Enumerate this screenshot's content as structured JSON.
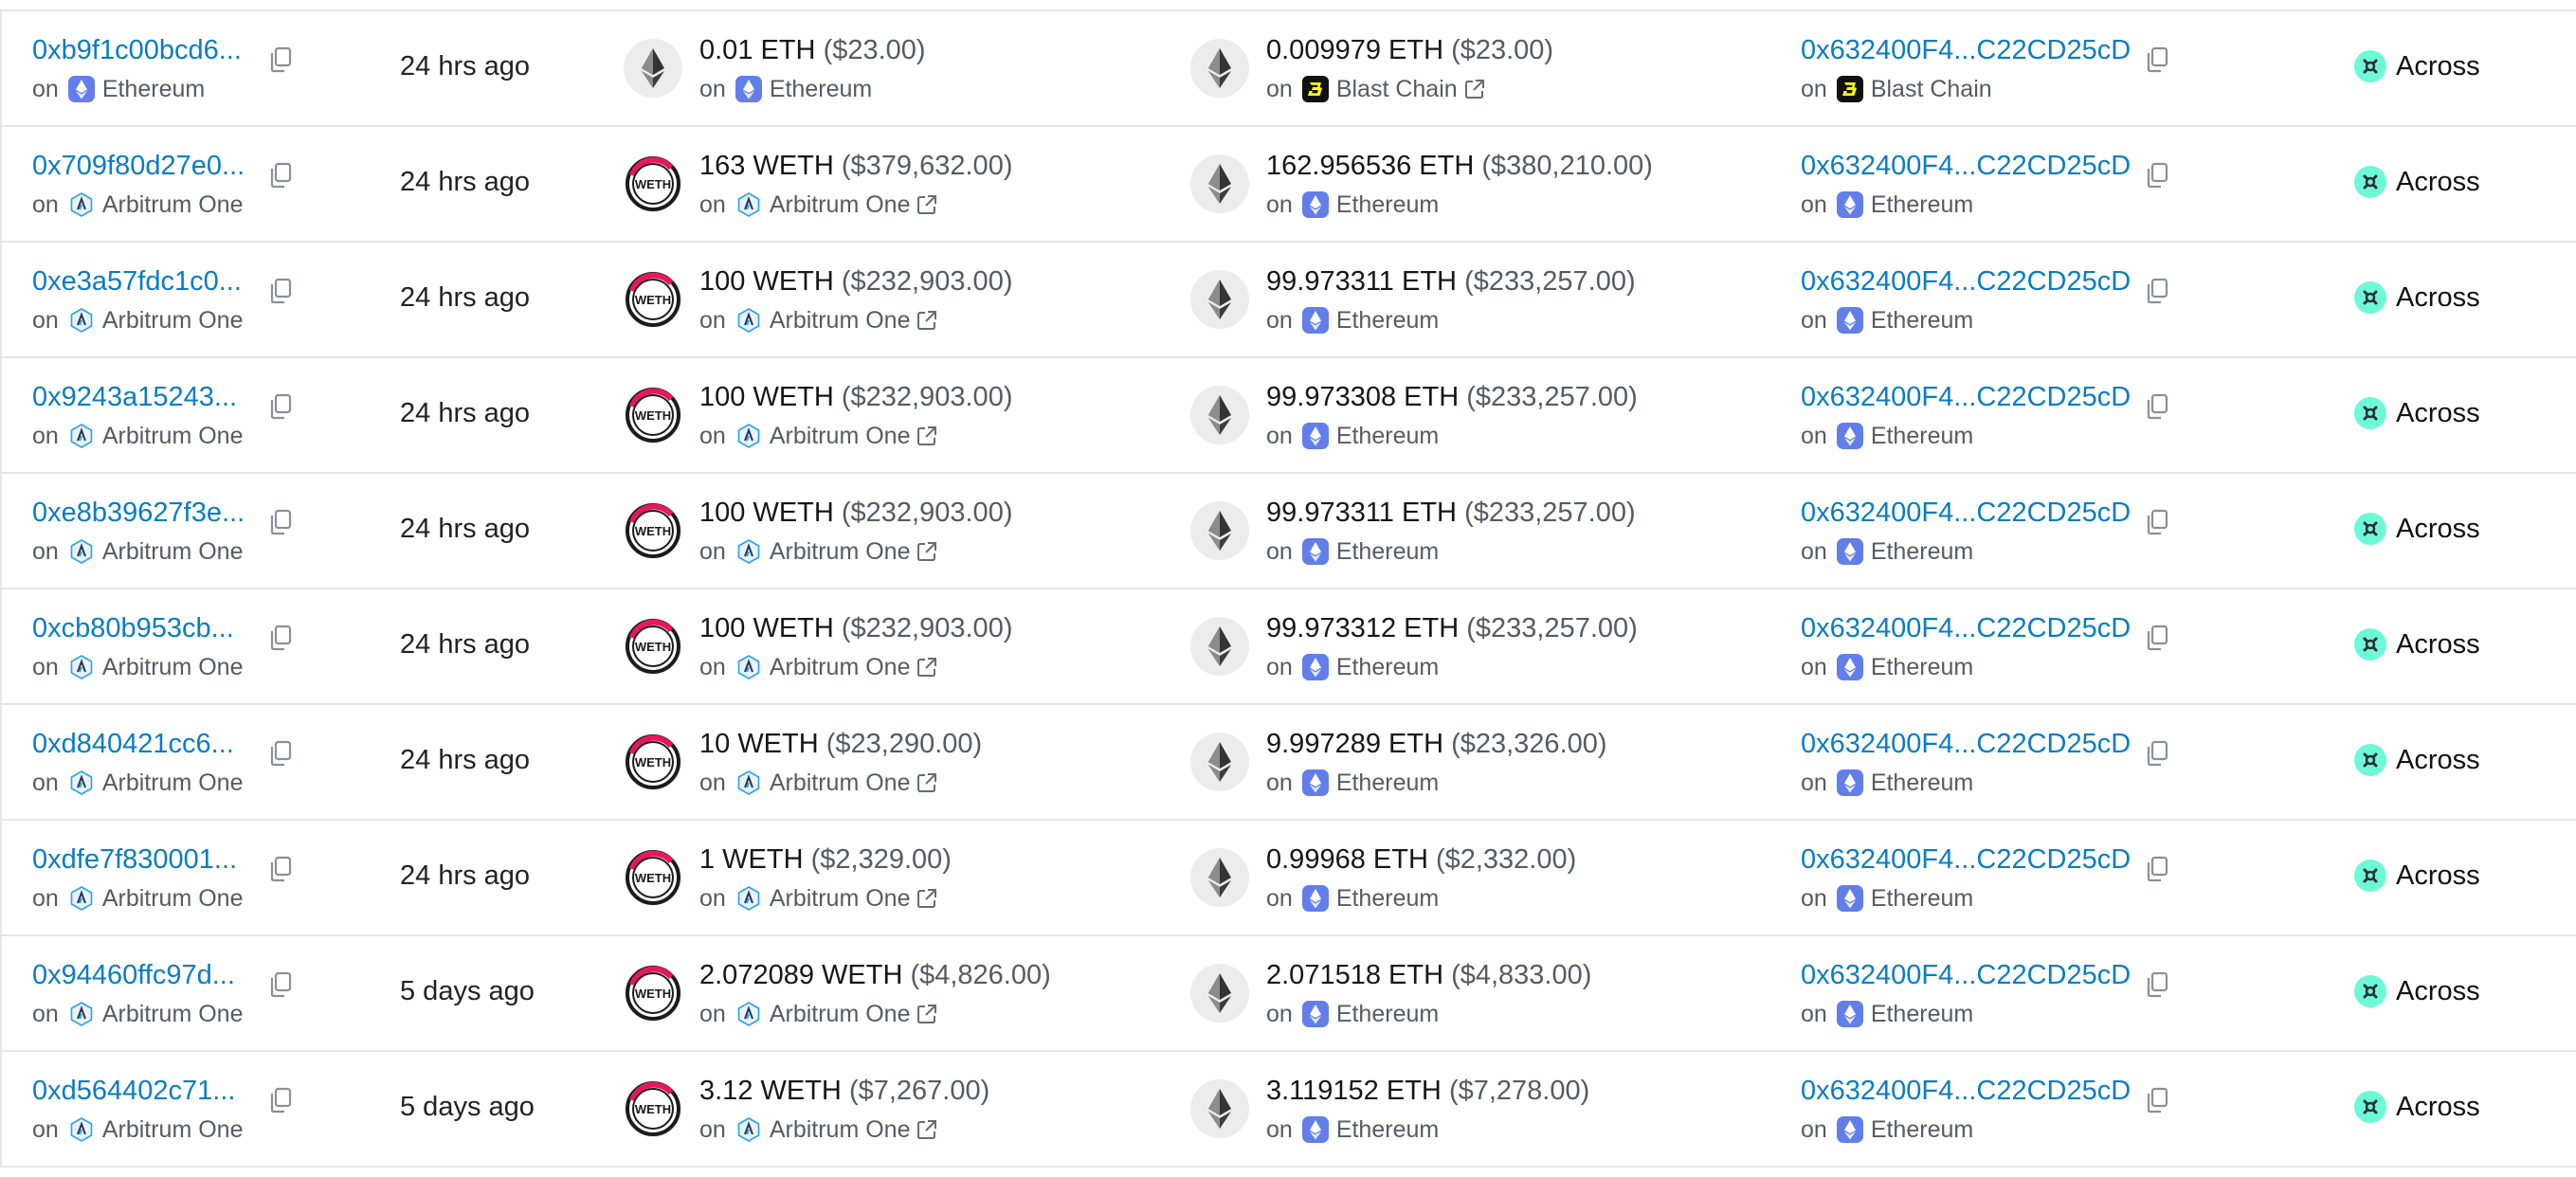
{
  "rows": [
    {
      "tx_hash": "0xb9f1c00bcd6...",
      "tx_chain": "Ethereum",
      "tx_chain_icon": "ethereum-icon",
      "time": "24 hrs ago",
      "from_token_icon": "eth-token-icon",
      "from_amount": "0.01 ETH",
      "from_usd": "($23.00)",
      "from_chain": "Ethereum",
      "from_chain_icon": "ethereum-icon",
      "from_external": false,
      "to_token_icon": "eth-token-icon",
      "to_amount": "0.009979 ETH",
      "to_usd": "($23.00)",
      "to_chain": "Blast Chain",
      "to_chain_icon": "blast-icon",
      "to_external": true,
      "address": "0x632400F4...C22CD25cD",
      "address_chain": "Blast Chain",
      "address_chain_icon": "blast-icon",
      "bridge": "Across"
    },
    {
      "tx_hash": "0x709f80d27e0...",
      "tx_chain": "Arbitrum One",
      "tx_chain_icon": "arbitrum-icon",
      "time": "24 hrs ago",
      "from_token_icon": "weth-token-icon",
      "from_amount": "163 WETH",
      "from_usd": "($379,632.00)",
      "from_chain": "Arbitrum One",
      "from_chain_icon": "arbitrum-icon",
      "from_external": true,
      "to_token_icon": "eth-token-icon",
      "to_amount": "162.956536 ETH",
      "to_usd": "($380,210.00)",
      "to_chain": "Ethereum",
      "to_chain_icon": "ethereum-icon",
      "to_external": false,
      "address": "0x632400F4...C22CD25cD",
      "address_chain": "Ethereum",
      "address_chain_icon": "ethereum-icon",
      "bridge": "Across"
    },
    {
      "tx_hash": "0xe3a57fdc1c0...",
      "tx_chain": "Arbitrum One",
      "tx_chain_icon": "arbitrum-icon",
      "time": "24 hrs ago",
      "from_token_icon": "weth-token-icon",
      "from_amount": "100 WETH",
      "from_usd": "($232,903.00)",
      "from_chain": "Arbitrum One",
      "from_chain_icon": "arbitrum-icon",
      "from_external": true,
      "to_token_icon": "eth-token-icon",
      "to_amount": "99.973311 ETH",
      "to_usd": "($233,257.00)",
      "to_chain": "Ethereum",
      "to_chain_icon": "ethereum-icon",
      "to_external": false,
      "address": "0x632400F4...C22CD25cD",
      "address_chain": "Ethereum",
      "address_chain_icon": "ethereum-icon",
      "bridge": "Across"
    },
    {
      "tx_hash": "0x9243a15243...",
      "tx_chain": "Arbitrum One",
      "tx_chain_icon": "arbitrum-icon",
      "time": "24 hrs ago",
      "from_token_icon": "weth-token-icon",
      "from_amount": "100 WETH",
      "from_usd": "($232,903.00)",
      "from_chain": "Arbitrum One",
      "from_chain_icon": "arbitrum-icon",
      "from_external": true,
      "to_token_icon": "eth-token-icon",
      "to_amount": "99.973308 ETH",
      "to_usd": "($233,257.00)",
      "to_chain": "Ethereum",
      "to_chain_icon": "ethereum-icon",
      "to_external": false,
      "address": "0x632400F4...C22CD25cD",
      "address_chain": "Ethereum",
      "address_chain_icon": "ethereum-icon",
      "bridge": "Across"
    },
    {
      "tx_hash": "0xe8b39627f3e...",
      "tx_chain": "Arbitrum One",
      "tx_chain_icon": "arbitrum-icon",
      "time": "24 hrs ago",
      "from_token_icon": "weth-token-icon",
      "from_amount": "100 WETH",
      "from_usd": "($232,903.00)",
      "from_chain": "Arbitrum One",
      "from_chain_icon": "arbitrum-icon",
      "from_external": true,
      "to_token_icon": "eth-token-icon",
      "to_amount": "99.973311 ETH",
      "to_usd": "($233,257.00)",
      "to_chain": "Ethereum",
      "to_chain_icon": "ethereum-icon",
      "to_external": false,
      "address": "0x632400F4...C22CD25cD",
      "address_chain": "Ethereum",
      "address_chain_icon": "ethereum-icon",
      "bridge": "Across"
    },
    {
      "tx_hash": "0xcb80b953cb...",
      "tx_chain": "Arbitrum One",
      "tx_chain_icon": "arbitrum-icon",
      "time": "24 hrs ago",
      "from_token_icon": "weth-token-icon",
      "from_amount": "100 WETH",
      "from_usd": "($232,903.00)",
      "from_chain": "Arbitrum One",
      "from_chain_icon": "arbitrum-icon",
      "from_external": true,
      "to_token_icon": "eth-token-icon",
      "to_amount": "99.973312 ETH",
      "to_usd": "($233,257.00)",
      "to_chain": "Ethereum",
      "to_chain_icon": "ethereum-icon",
      "to_external": false,
      "address": "0x632400F4...C22CD25cD",
      "address_chain": "Ethereum",
      "address_chain_icon": "ethereum-icon",
      "bridge": "Across"
    },
    {
      "tx_hash": "0xd840421cc6...",
      "tx_chain": "Arbitrum One",
      "tx_chain_icon": "arbitrum-icon",
      "time": "24 hrs ago",
      "from_token_icon": "weth-token-icon",
      "from_amount": "10 WETH",
      "from_usd": "($23,290.00)",
      "from_chain": "Arbitrum One",
      "from_chain_icon": "arbitrum-icon",
      "from_external": true,
      "to_token_icon": "eth-token-icon",
      "to_amount": "9.997289 ETH",
      "to_usd": "($23,326.00)",
      "to_chain": "Ethereum",
      "to_chain_icon": "ethereum-icon",
      "to_external": false,
      "address": "0x632400F4...C22CD25cD",
      "address_chain": "Ethereum",
      "address_chain_icon": "ethereum-icon",
      "bridge": "Across"
    },
    {
      "tx_hash": "0xdfe7f830001...",
      "tx_chain": "Arbitrum One",
      "tx_chain_icon": "arbitrum-icon",
      "time": "24 hrs ago",
      "from_token_icon": "weth-token-icon",
      "from_amount": "1 WETH",
      "from_usd": "($2,329.00)",
      "from_chain": "Arbitrum One",
      "from_chain_icon": "arbitrum-icon",
      "from_external": true,
      "to_token_icon": "eth-token-icon",
      "to_amount": "0.99968 ETH",
      "to_usd": "($2,332.00)",
      "to_chain": "Ethereum",
      "to_chain_icon": "ethereum-icon",
      "to_external": false,
      "address": "0x632400F4...C22CD25cD",
      "address_chain": "Ethereum",
      "address_chain_icon": "ethereum-icon",
      "bridge": "Across"
    },
    {
      "tx_hash": "0x94460ffc97d...",
      "tx_chain": "Arbitrum One",
      "tx_chain_icon": "arbitrum-icon",
      "time": "5 days ago",
      "from_token_icon": "weth-token-icon",
      "from_amount": "2.072089 WETH",
      "from_usd": "($4,826.00)",
      "from_chain": "Arbitrum One",
      "from_chain_icon": "arbitrum-icon",
      "from_external": true,
      "to_token_icon": "eth-token-icon",
      "to_amount": "2.071518 ETH",
      "to_usd": "($4,833.00)",
      "to_chain": "Ethereum",
      "to_chain_icon": "ethereum-icon",
      "to_external": false,
      "address": "0x632400F4...C22CD25cD",
      "address_chain": "Ethereum",
      "address_chain_icon": "ethereum-icon",
      "bridge": "Across"
    },
    {
      "tx_hash": "0xd564402c71...",
      "tx_chain": "Arbitrum One",
      "tx_chain_icon": "arbitrum-icon",
      "time": "5 days ago",
      "from_token_icon": "weth-token-icon",
      "from_amount": "3.12 WETH",
      "from_usd": "($7,267.00)",
      "from_chain": "Arbitrum One",
      "from_chain_icon": "arbitrum-icon",
      "from_external": true,
      "to_token_icon": "eth-token-icon",
      "to_amount": "3.119152 ETH",
      "to_usd": "($7,278.00)",
      "to_chain": "Ethereum",
      "to_chain_icon": "ethereum-icon",
      "to_external": false,
      "address": "0x632400F4...C22CD25cD",
      "address_chain": "Ethereum",
      "address_chain_icon": "ethereum-icon",
      "bridge": "Across"
    }
  ],
  "labels": {
    "on": "on"
  },
  "colors": {
    "link": "#0a7cc4",
    "muted_text": "#555b63",
    "border": "#e6e6e6",
    "ethereum_chain": "#627eea",
    "arbitrum": "#28a0f0",
    "blast_bg": "#111111",
    "blast_yellow": "#fcfc03",
    "weth_ring": "#e8175d",
    "across_teal": "#6cf9d8"
  }
}
